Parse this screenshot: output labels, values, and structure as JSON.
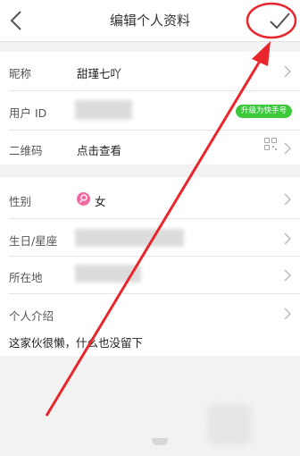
{
  "header": {
    "title": "编辑个人资料"
  },
  "fields": {
    "nickname": {
      "label": "昵称",
      "value": "甜瑾七吖"
    },
    "user_id": {
      "label": "用户 ID",
      "badge": "升级为快手号"
    },
    "qrcode": {
      "label": "二维码",
      "value": "点击查看"
    },
    "gender": {
      "label": "性别",
      "value": "女"
    },
    "birthday": {
      "label": "生日/星座"
    },
    "location": {
      "label": "所在地"
    },
    "intro": {
      "label": "个人介绍",
      "value": "这家伙很懒，什么也没留下"
    }
  },
  "icons": [
    "back-icon",
    "check-icon",
    "chevron-right-icon",
    "qrcode-icon",
    "female-icon"
  ],
  "colors": {
    "accent_link": "#3a7bd5",
    "badge": "#3cc93c",
    "annotation": "#e8262b",
    "female": "#f06aa0"
  }
}
